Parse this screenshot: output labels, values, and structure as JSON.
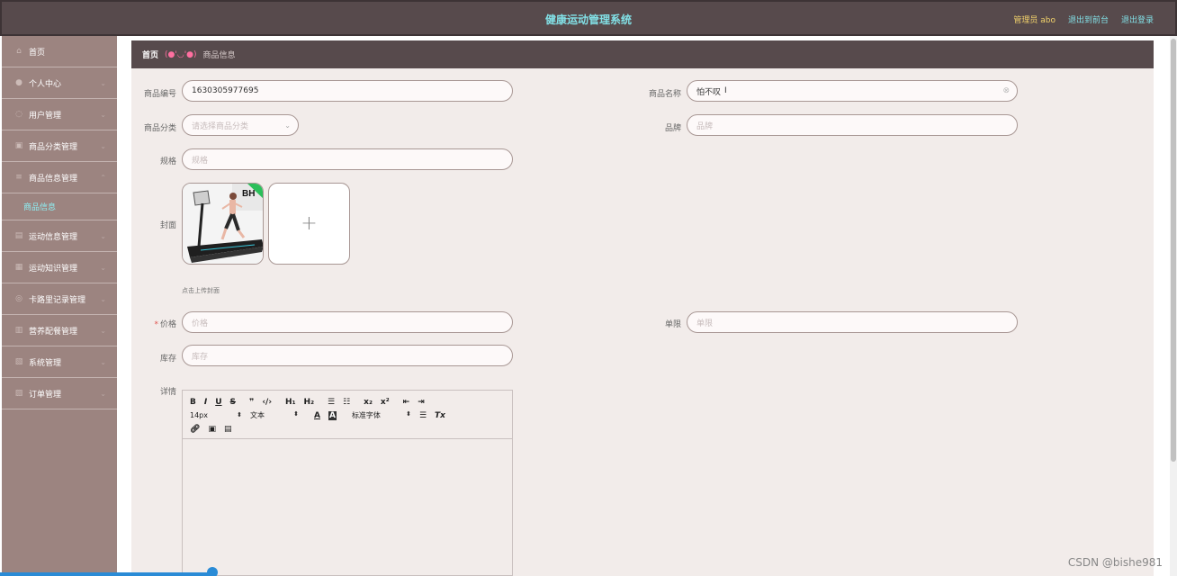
{
  "header": {
    "title": "健康运动管理系统",
    "admin": "管理员 abo",
    "to_front": "退出到前台",
    "logout": "退出登录"
  },
  "sidebar": {
    "items": [
      {
        "label": "首页",
        "icon": "home-icon"
      },
      {
        "label": "个人中心",
        "icon": "user-icon"
      },
      {
        "label": "用户管理",
        "icon": "users-icon"
      },
      {
        "label": "商品分类管理",
        "icon": "category-icon"
      },
      {
        "label": "商品信息管理",
        "icon": "goods-icon"
      },
      {
        "label": "运动信息管理",
        "icon": "sport-icon"
      },
      {
        "label": "运动知识管理",
        "icon": "knowledge-icon"
      },
      {
        "label": "卡路里记录管理",
        "icon": "calorie-icon"
      },
      {
        "label": "营养配餐管理",
        "icon": "meal-icon"
      },
      {
        "label": "系统管理",
        "icon": "system-icon"
      },
      {
        "label": "订单管理",
        "icon": "order-icon"
      }
    ],
    "sub_active": "商品信息"
  },
  "breadcrumb": {
    "home": "首页",
    "sep": "(●'◡'●)",
    "current": "商品信息"
  },
  "form": {
    "code_label": "商品编号",
    "code_value": "1630305977695",
    "name_label": "商品名称",
    "name_value": "怕不叹",
    "category_label": "商品分类",
    "category_placeholder": "请选择商品分类",
    "brand_label": "品牌",
    "brand_placeholder": "品牌",
    "spec_label": "规格",
    "spec_placeholder": "规格",
    "cover_label": "封面",
    "cover_hint": "点击上传封面",
    "price_label": "价格",
    "price_placeholder": "价格",
    "limit_label": "单限",
    "limit_placeholder": "单限",
    "stock_label": "库存",
    "stock_placeholder": "库存",
    "detail_label": "详情"
  },
  "editor": {
    "font_size": "14px",
    "text_type": "文本",
    "font_family": "标准字体"
  },
  "watermark": "CSDN @bishe981"
}
